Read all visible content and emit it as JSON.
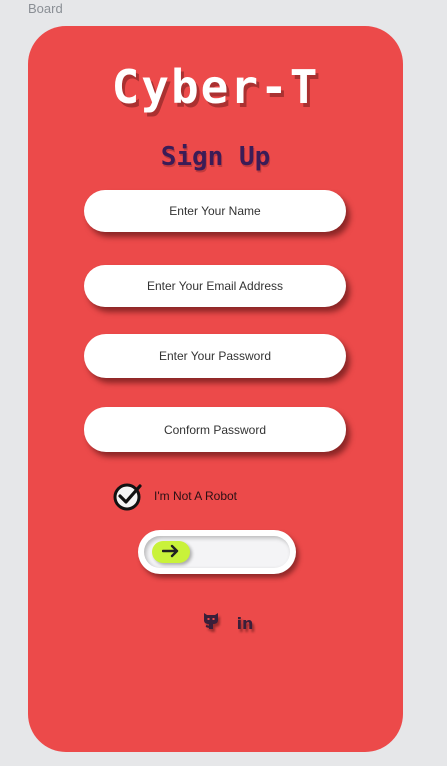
{
  "board": {
    "label": "Board"
  },
  "colors": {
    "background": "#e6e7e9",
    "card": "#ec4a4a",
    "title": "#3b1c57",
    "knob": "#c9f23a"
  },
  "logo": {
    "text": "Cyber-T"
  },
  "form": {
    "title": "Sign Up",
    "fields": [
      {
        "name": "name",
        "placeholder": "Enter Your Name",
        "value": ""
      },
      {
        "name": "email",
        "placeholder": "Enter Your Email Address",
        "value": ""
      },
      {
        "name": "password",
        "placeholder": "Enter Your Password",
        "value": ""
      },
      {
        "name": "confirm",
        "placeholder": "Conform Password",
        "value": ""
      }
    ],
    "robot_check": {
      "label": "I'm Not A Robot",
      "icon": "check-circle-icon",
      "checked": true
    },
    "submit_slider": {
      "icon": "arrow-right-icon",
      "progress": 0
    }
  },
  "social": [
    {
      "icon": "github-icon"
    },
    {
      "icon": "linkedin-icon",
      "text": "in"
    }
  ]
}
